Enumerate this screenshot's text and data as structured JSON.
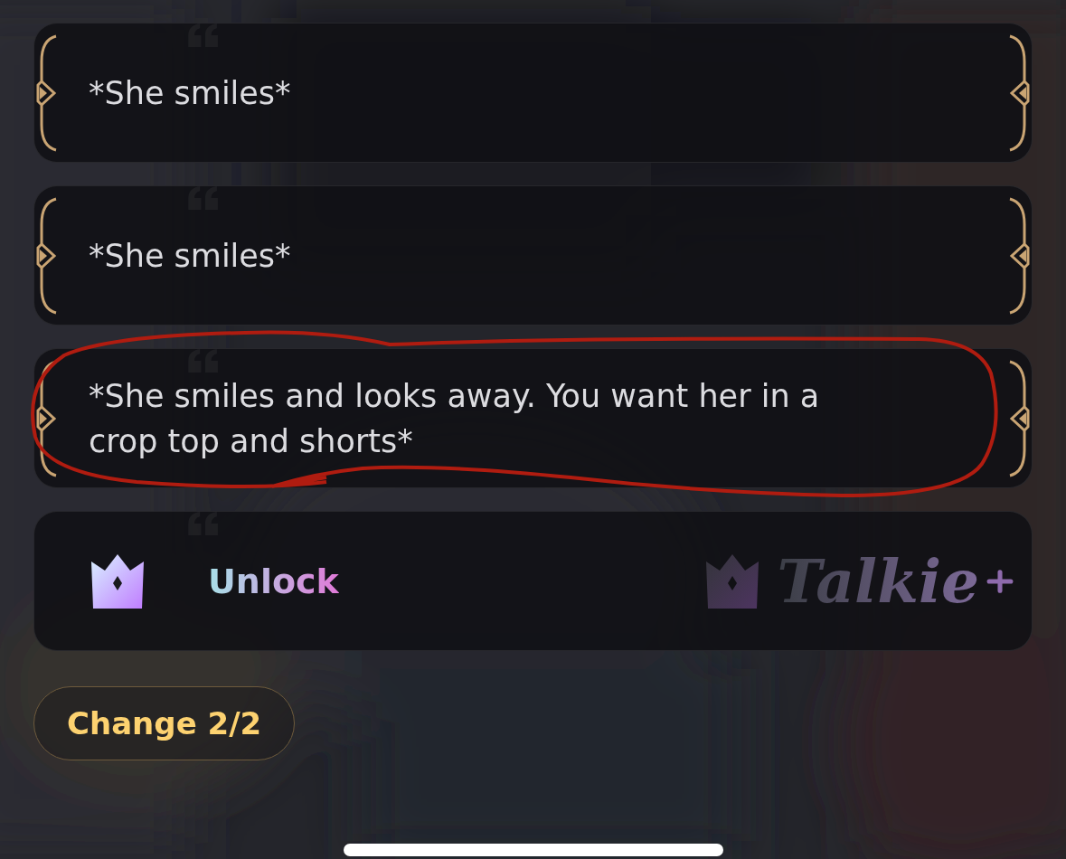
{
  "options": [
    {
      "text": "*She smiles*",
      "highlighted": false
    },
    {
      "text": "*She smiles*",
      "highlighted": false
    },
    {
      "text": "*She smiles and looks away. You want her in a crop top and shorts*",
      "highlighted": true
    }
  ],
  "unlock": {
    "label": "Unlock",
    "brand": "Talkie"
  },
  "change_button": {
    "label": "Change 2/2"
  }
}
